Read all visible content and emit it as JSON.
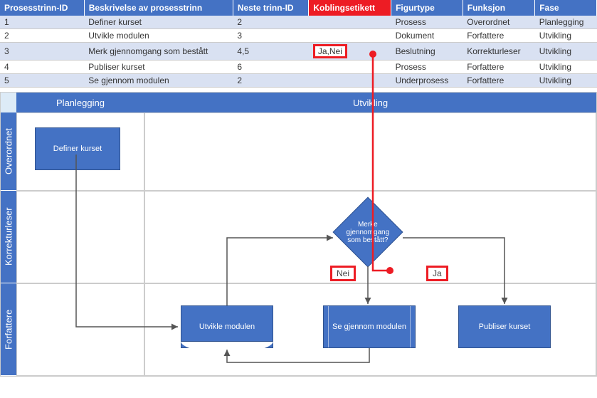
{
  "table": {
    "headers": {
      "step_id": "Prosesstrinn-ID",
      "desc": "Beskrivelse av prosesstrinn",
      "next": "Neste trinn-ID",
      "connector": "Koblingsetikett",
      "shape": "Figurtype",
      "role": "Funksjon",
      "phase": "Fase"
    },
    "rows": [
      {
        "id": "1",
        "desc": "Definer kurset",
        "next": "2",
        "conn": "",
        "shape": "Prosess",
        "role": "Overordnet",
        "phase": "Planlegging"
      },
      {
        "id": "2",
        "desc": "Utvikle modulen",
        "next": "3",
        "conn": "",
        "shape": "Dokument",
        "role": "Forfattere",
        "phase": "Utvikling"
      },
      {
        "id": "3",
        "desc": "Merk gjennomgang som bestått",
        "next": "4,5",
        "conn": "Ja,Nei",
        "shape": "Beslutning",
        "role": "Korrekturleser",
        "phase": "Utvikling"
      },
      {
        "id": "4",
        "desc": "Publiser kurset",
        "next": "6",
        "conn": "",
        "shape": "Prosess",
        "role": "Forfattere",
        "phase": "Utvikling"
      },
      {
        "id": "5",
        "desc": "Se gjennom modulen",
        "next": "2",
        "conn": "",
        "shape": "Underprosess",
        "role": "Forfattere",
        "phase": "Utvikling"
      }
    ]
  },
  "swimlane": {
    "phase_headers": {
      "planning": "Planlegging",
      "dev": "Utvikling"
    },
    "lane_headers": {
      "owner": "Overordnet",
      "proof": "Korrekturleser",
      "author": "Forfattere"
    },
    "shapes": {
      "define": "Definer kurset",
      "decision": "Merke gjennomgang som bestått?",
      "develop": "Utvikle modulen",
      "review": "Se gjennom modulen",
      "publish": "Publiser kurset"
    },
    "labels": {
      "no": "Nei",
      "yes": "Ja"
    }
  }
}
